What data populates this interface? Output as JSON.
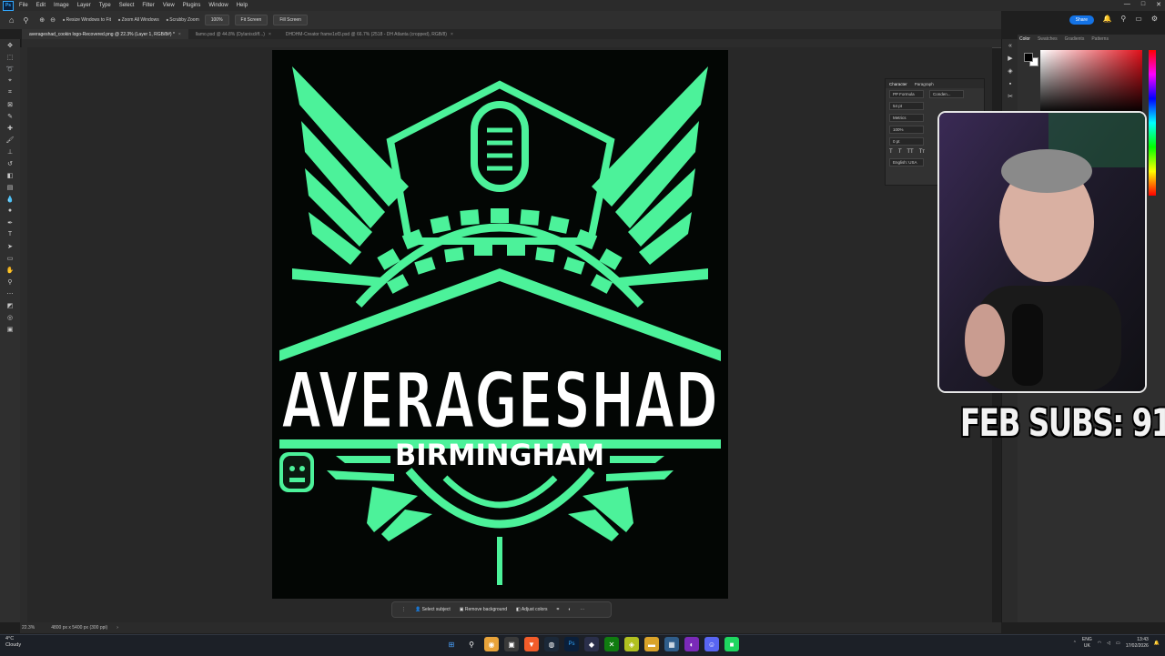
{
  "app": {
    "logo_text": "Ps",
    "menu": [
      "File",
      "Edit",
      "Image",
      "Layer",
      "Type",
      "Select",
      "Filter",
      "View",
      "Plugins",
      "Window",
      "Help"
    ],
    "window_controls": [
      "—",
      "□",
      "✕"
    ]
  },
  "options_bar": {
    "resize_windows": "Resize Windows to Fit",
    "zoom_all_windows": "Zoom All Windows",
    "scrubby_zoom": "Scrubby Zoom",
    "zoom_value": "100%",
    "fit_screen": "Fit Screen",
    "fill_screen": "Fill Screen",
    "share": "Share"
  },
  "tabs": [
    {
      "label": "averageshad_cookin logo-Recovered.png @ 22.3% (Layer 1, RGB/8#) *",
      "active": true
    },
    {
      "label": "llamo.psd @ 44.8% (Dylaniscliff...)",
      "active": false
    },
    {
      "label": "DHDHM-Creator frame1of3.psd @ 66.7% (2518 - DH Atlanta (cropped), RGB/8)",
      "active": false
    }
  ],
  "canvas": {
    "logo_main_text": "AVERAGESHAD",
    "logo_sub_text": "BIRMINGHAM",
    "bg_color": "#030604",
    "green": "#4cf29a"
  },
  "context_bar": {
    "select_subject": "Select subject",
    "remove_background": "Remove background",
    "adjust_colors": "Adjust colors"
  },
  "status_bar": {
    "zoom": "22.3%",
    "doc_info": "4800 px x 5400 px (300 ppi)"
  },
  "right_panel": {
    "tabs": [
      "Color",
      "Swatches",
      "Gradients",
      "Patterns"
    ]
  },
  "character_panel": {
    "tabs": [
      "Character",
      "Paragraph"
    ],
    "font": "PP Formula",
    "style": "Conden...",
    "size": "54 pt",
    "kerning": "Metrics",
    "scale": "100%",
    "baseline": "0 pt",
    "language": "English: USA"
  },
  "overlay": {
    "subs_text": "FEB SUBS: 91"
  },
  "taskbar": {
    "weather_temp": "4°C",
    "weather_desc": "Cloudy",
    "lang_top": "ENG",
    "lang_bottom": "UK",
    "time": "13:43",
    "date": "17/02/2026"
  }
}
